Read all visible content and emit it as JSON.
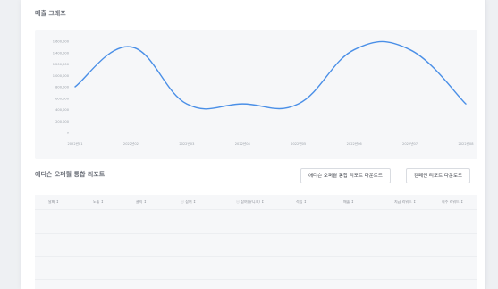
{
  "sales": {
    "title": "매출 그래프"
  },
  "chart_data": {
    "type": "line",
    "title": "매출 그래프",
    "xlabel": "",
    "ylabel": "",
    "categories": [
      "2022년01",
      "2022년02",
      "2022년03",
      "2022년04",
      "2022년05",
      "2022년06",
      "2022년07",
      "2022년08"
    ],
    "series": [
      {
        "values": [
          800000,
          1500000,
          500000,
          500000,
          500000,
          1450000,
          1450000,
          500000
        ]
      }
    ],
    "ylim": [
      0,
      1600000
    ],
    "yticks": [
      "1,600,000",
      "1,400,000",
      "1,200,000",
      "1,000,000",
      "800,000",
      "600,000",
      "400,000",
      "200,000",
      "0"
    ],
    "xticks": [
      "2022년01",
      "2022년02",
      "2022년03",
      "2022년04",
      "2022년05",
      "2022년06",
      "2022년07",
      "2022년08"
    ],
    "grid": false,
    "color": "#4a8fe7"
  },
  "report": {
    "title": "애디슨 오퍼월 통합 리포트",
    "download_integrated": "애디슨 오퍼월 통합 리포트 다운로드",
    "download_campaign": "캠페인 리포트 다운로드",
    "columns": [
      "날짜 ↕",
      "노출 ↕",
      "클릭 ↕",
      "ⓘ 참여 ↕",
      "ⓘ 참여(유니크) ↕",
      "적립 ↕",
      "매출 ↕",
      "지급 리워드 ↕",
      "회수 리워드 ↕"
    ]
  }
}
